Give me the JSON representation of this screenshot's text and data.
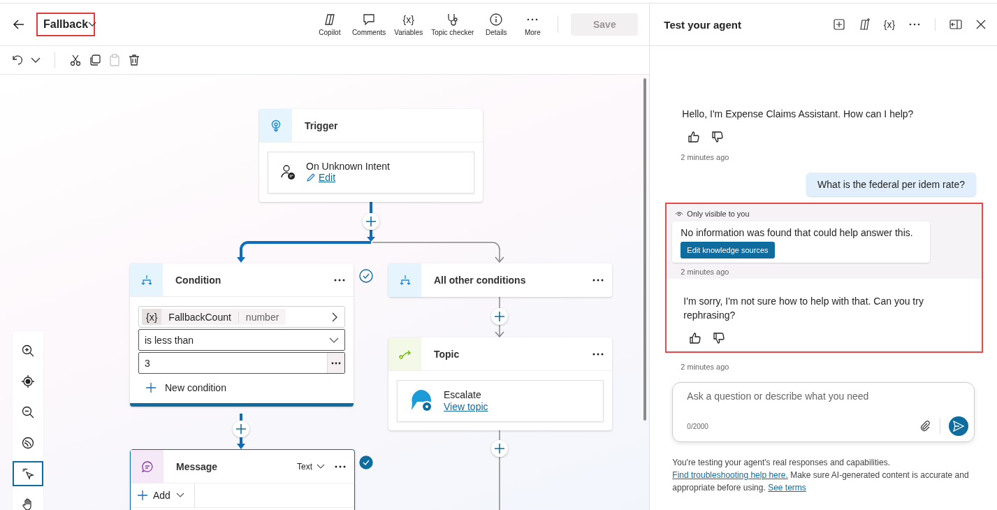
{
  "header": {
    "topic_title": "Fallback",
    "highlighted": true,
    "actions": [
      {
        "kind": "copilot",
        "label": "Copilot"
      },
      {
        "kind": "comments",
        "label": "Comments"
      },
      {
        "kind": "variables",
        "label": "Variables",
        "glyph": "{x}"
      },
      {
        "kind": "checker",
        "label": "Topic checker"
      },
      {
        "kind": "details",
        "label": "Details"
      },
      {
        "kind": "more",
        "label": "More"
      }
    ],
    "save": {
      "label": "Save",
      "disabled": true
    }
  },
  "edit_toolbar": [
    {
      "kind": "undo",
      "disabled": false
    },
    {
      "kind": "caret",
      "disabled": false
    },
    {
      "kind": "cut",
      "disabled": false
    },
    {
      "kind": "copy",
      "disabled": false
    },
    {
      "kind": "paste",
      "disabled": true
    },
    {
      "kind": "delete",
      "disabled": false
    }
  ],
  "canvas": {
    "trigger": {
      "title": "Trigger",
      "event": "On Unknown Intent",
      "link": "Edit"
    },
    "condition": {
      "title": "Condition",
      "variable_glyph": "{x}",
      "variable": "FallbackCount",
      "type": "number",
      "operator": "is less than",
      "value": "3",
      "add_label": "New condition",
      "checked": false
    },
    "other": {
      "title": "All other conditions"
    },
    "topic": {
      "title": "Topic",
      "name": "Escalate",
      "link": "View topic"
    },
    "message": {
      "title": "Message",
      "format": "Text",
      "add_label": "Add",
      "checked": true
    }
  },
  "zoom_controls": [
    {
      "kind": "zoom-in",
      "selected": false
    },
    {
      "kind": "recenter",
      "selected": false
    },
    {
      "kind": "zoom-out",
      "selected": false
    },
    {
      "kind": "minimap",
      "selected": false
    },
    {
      "kind": "select",
      "selected": true
    },
    {
      "kind": "pan",
      "selected": false
    }
  ],
  "test_panel": {
    "title": "Test your agent",
    "tools": [
      {
        "kind": "new"
      },
      {
        "kind": "copilot"
      },
      {
        "kind": "variables",
        "glyph": "{x}"
      },
      {
        "kind": "more"
      },
      {
        "kind": "dock"
      },
      {
        "kind": "close"
      }
    ],
    "greeting": {
      "text": "Hello, I'm Expense Claims Assistant. How can I help?",
      "time": "2 minutes ago"
    },
    "user_message": "What is the federal per idem rate?",
    "highlight": {
      "private_label": "Only visible to you",
      "notice": "No information was found that could help answer this.",
      "button": "Edit knowledge sources",
      "private_time": "2 minutes ago",
      "reply": "I'm sorry, I'm not sure how to help with that. Can you try rephrasing?"
    },
    "reply_time": "2 minutes ago",
    "input": {
      "placeholder": "Ask a question or describe what you need",
      "counter": "0/2000"
    },
    "disclaimer": [
      {
        "kind": "text",
        "text": "You're testing your agent's real responses and capabilities."
      },
      {
        "kind": "link",
        "text": "Find troubleshooting help here."
      },
      {
        "kind": "text",
        "text": "Make sure AI-generated content is accurate and appropriate before using."
      },
      {
        "kind": "link",
        "text": "See terms"
      }
    ]
  }
}
